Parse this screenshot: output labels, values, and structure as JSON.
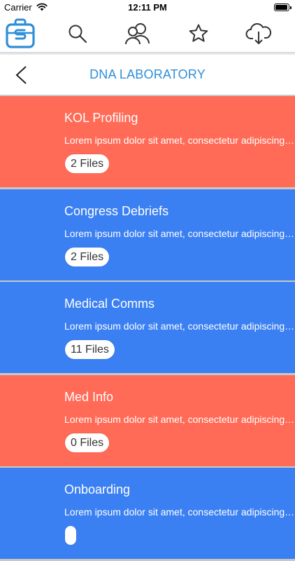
{
  "status_bar": {
    "carrier": "Carrier",
    "time": "12:11 PM",
    "battery_level": 0.95
  },
  "toolbar": {
    "items": [
      {
        "icon": "briefcase-logo-icon",
        "active": true
      },
      {
        "icon": "search-icon"
      },
      {
        "icon": "people-icon"
      },
      {
        "icon": "star-icon"
      },
      {
        "icon": "cloud-download-icon"
      }
    ],
    "accent_color": "#2e8ed8"
  },
  "navbar": {
    "back_icon": "chevron-left-icon",
    "title": "DNA LABORATORY"
  },
  "colors": {
    "red": "#ff6b57",
    "blue": "#3b80f2"
  },
  "cards": [
    {
      "title": "KOL Profiling",
      "description": "Lorem ipsum dolor sit amet, consectetur adipiscing elit",
      "files": "2 Files",
      "color": "#ff6b57"
    },
    {
      "title": "Congress Debriefs",
      "description": "Lorem ipsum dolor sit amet, consectetur adipiscing elit",
      "files": "2 Files",
      "color": "#3b80f2"
    },
    {
      "title": "Medical Comms",
      "description": "Lorem ipsum dolor sit amet, consectetur adipiscing elit",
      "files": "11 Files",
      "color": "#3b80f2"
    },
    {
      "title": "Med Info",
      "description": "Lorem ipsum dolor sit amet, consectetur adipiscing elit",
      "files": "0 Files",
      "color": "#ff6b57"
    },
    {
      "title": "Onboarding",
      "description": "Lorem ipsum dolor sit amet, consectetur adipiscing elit",
      "files": "",
      "color": "#3b80f2"
    }
  ]
}
